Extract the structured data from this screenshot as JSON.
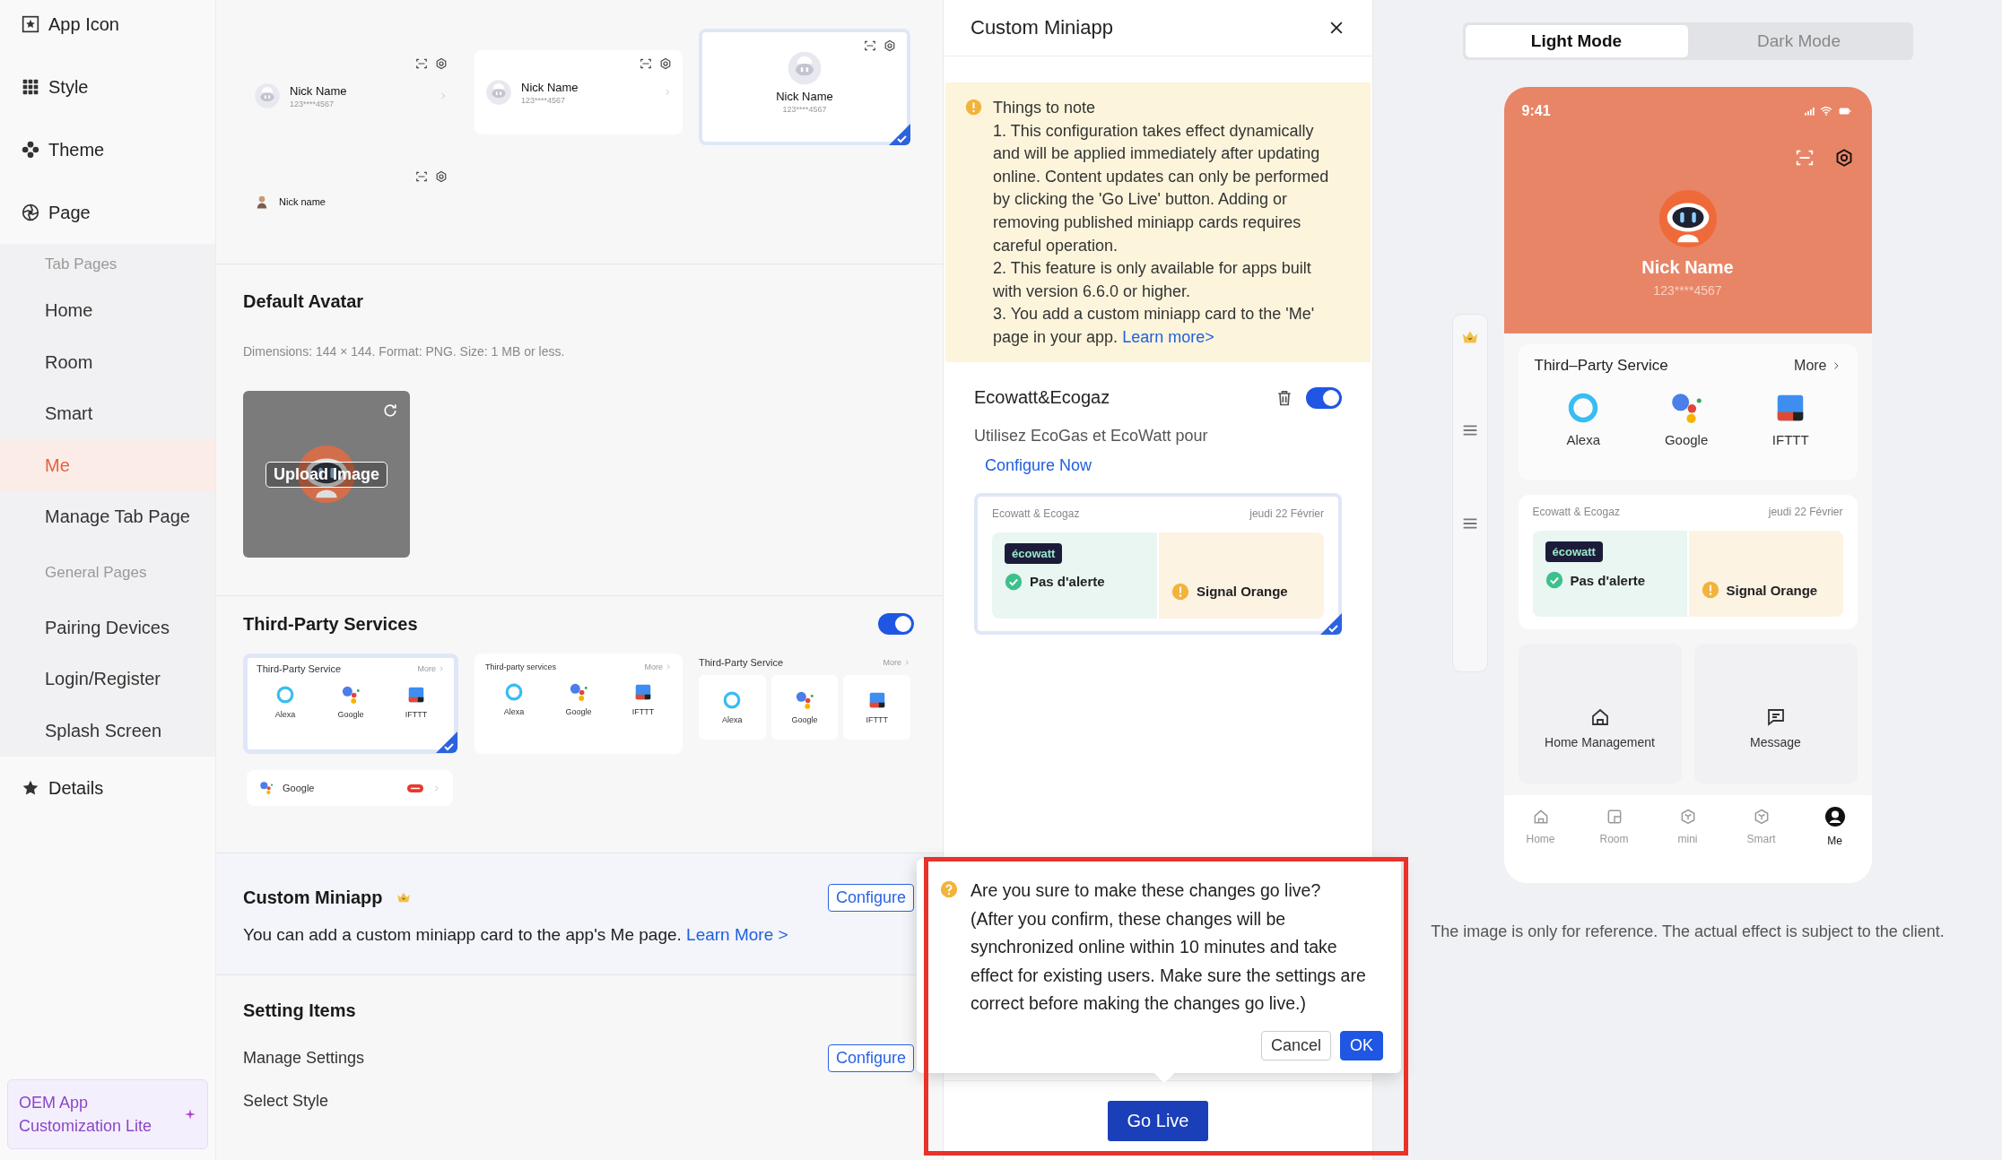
{
  "sidebar": {
    "items": [
      {
        "label": "App Icon",
        "kind": "app"
      },
      {
        "label": "Style",
        "kind": "grid"
      },
      {
        "label": "Theme",
        "kind": "theme"
      },
      {
        "label": "Page",
        "kind": "page",
        "children": [
          {
            "heading": "Tab Pages",
            "children": [
              {
                "label": "Home",
                "selected": false
              },
              {
                "label": "Room",
                "selected": false
              },
              {
                "label": "Smart",
                "selected": false
              },
              {
                "label": "Me",
                "selected": true
              },
              {
                "label": "Manage Tab Page",
                "selected": false
              }
            ]
          },
          {
            "heading": "General Pages",
            "children": [
              {
                "label": "Pairing Devices",
                "selected": false
              },
              {
                "label": "Login/Register",
                "selected": false
              },
              {
                "label": "Splash Screen",
                "selected": false
              }
            ]
          }
        ]
      },
      {
        "label": "Details",
        "kind": "star"
      }
    ],
    "promo": "OEM App Customization Lite"
  },
  "avatar_styles": [
    {
      "kind": "row",
      "name": "Nick Name",
      "phone": "123****4567",
      "selected": false
    },
    {
      "kind": "card",
      "name": "Nick Name",
      "phone": "123****4567",
      "selected": false
    },
    {
      "kind": "center",
      "name": "Nick Name",
      "phone": "123****4567",
      "selected": true
    },
    {
      "kind": "compact",
      "name": "Nick name",
      "selected": false
    }
  ],
  "default_avatar": {
    "title": "Default Avatar",
    "hint": "Dimensions: 144 × 144. Format: PNG. Size: 1 MB or less.",
    "action": "Upload Image"
  },
  "third_party": {
    "title": "Third-Party Services",
    "on": true,
    "styles": [
      {
        "kind": "card",
        "title": "Third-Party Service",
        "more": "More",
        "selected": true,
        "services": [
          {
            "label": "Alexa",
            "kind": "ring"
          },
          {
            "label": "Google",
            "kind": "dots"
          },
          {
            "label": "IFTTT",
            "kind": "square"
          }
        ]
      },
      {
        "kind": "plain",
        "title": "Third-party services",
        "more": "More",
        "selected": false,
        "services": [
          {
            "label": "Alexa",
            "kind": "ring"
          },
          {
            "label": "Google",
            "kind": "dots"
          },
          {
            "label": "IFTTT",
            "kind": "square"
          }
        ]
      },
      {
        "kind": "tiles",
        "title": "Third-Party Service",
        "more": "More",
        "selected": false,
        "services": [
          {
            "label": "Alexa",
            "kind": "ring"
          },
          {
            "label": "Google",
            "kind": "dots"
          },
          {
            "label": "IFTTT",
            "kind": "square"
          }
        ]
      },
      {
        "kind": "list",
        "title": "Google",
        "selected": false
      }
    ]
  },
  "custom_miniapp": {
    "title": "Custom Miniapp",
    "description": "You can add a custom miniapp card to the app's Me page.",
    "link": "Learn More >",
    "action": "Configure"
  },
  "setting_items": {
    "title": "Setting Items",
    "rows": [
      {
        "label": "Manage Settings",
        "action": "Configure"
      },
      {
        "label": "Select Style"
      }
    ]
  },
  "drawer": {
    "title": "Custom Miniapp",
    "note": {
      "title": "Things to note",
      "items": [
        "1. This configuration takes effect dynamically and will be applied immediately after updating online. Content updates can only be performed by clicking the 'Go Live' button. Adding or removing published miniapp cards requires careful operation.",
        "2. This feature is only available for apps built with version 6.6.0 or higher.",
        "3. You add a custom miniapp card to the 'Me' page in your app."
      ],
      "link": "Learn more>"
    },
    "miniapp": {
      "name": "Ecowatt&Ecogaz",
      "on": true,
      "description": "Utilisez EcoGas et EcoWatt pour",
      "link": "Configure Now",
      "selected": true,
      "card": {
        "title": "Ecowatt & Ecogaz",
        "date": "jeudi 22 Février",
        "logo": "écowatt",
        "left": "Pas d'alerte",
        "right": "Signal Orange"
      }
    },
    "action": "Go Live"
  },
  "confirm": {
    "question": "Are you sure to make these changes go live?",
    "details": "(After you confirm, these changes will be synchronized online within 10 minutes and take effect for existing users. Make sure the settings are correct before making the changes go live.)",
    "cancel": "Cancel",
    "ok": "OK"
  },
  "preview": {
    "modes": [
      {
        "label": "Light Mode",
        "selected": true
      },
      {
        "label": "Dark Mode",
        "selected": false
      }
    ],
    "phone": {
      "time": "9:41",
      "name": "Nick Name",
      "phone": "123****4567",
      "services": {
        "title": "Third–Party Service",
        "more": "More",
        "items": [
          {
            "label": "Alexa",
            "kind": "ring"
          },
          {
            "label": "Google",
            "kind": "dots"
          },
          {
            "label": "IFTTT",
            "kind": "square"
          }
        ]
      },
      "card": {
        "title": "Ecowatt & Ecogaz",
        "date": "jeudi 22 Février",
        "logo": "écowatt",
        "left": "Pas d'alerte",
        "right": "Signal Orange"
      },
      "shortcuts": [
        {
          "label": "Home Management",
          "kind": "house"
        },
        {
          "label": "Message",
          "kind": "message"
        }
      ],
      "tabs": [
        {
          "label": "Home",
          "kind": "house",
          "selected": false
        },
        {
          "label": "Room",
          "kind": "room",
          "selected": false
        },
        {
          "label": "mini",
          "kind": "cube",
          "selected": false
        },
        {
          "label": "Smart",
          "kind": "cube",
          "selected": false
        },
        {
          "label": "Me",
          "kind": "me",
          "selected": true
        }
      ]
    },
    "footnote": "The image is only for reference. The actual effect is subject to the client."
  }
}
